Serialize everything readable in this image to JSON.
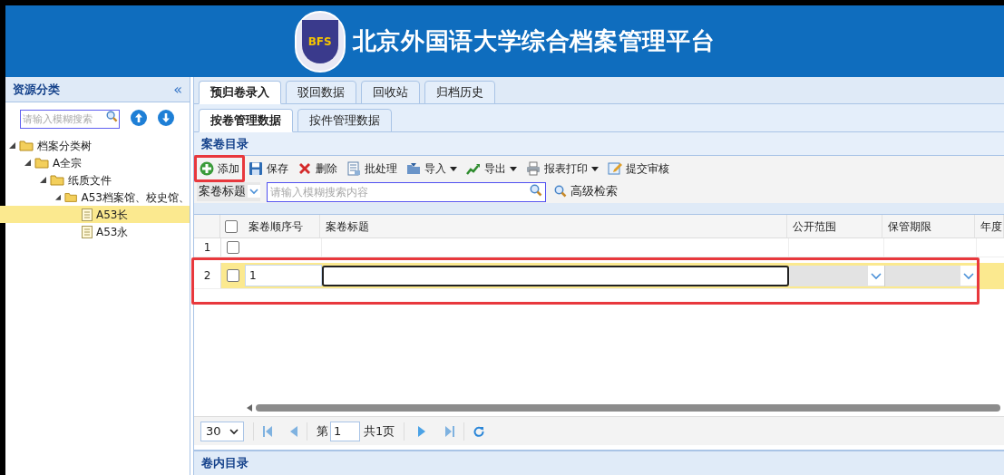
{
  "header": {
    "title": "北京外国语大学综合档案管理平台",
    "logo_text": "BFS"
  },
  "sidebar": {
    "title": "资源分类",
    "collapse": "«",
    "search": {
      "placeholder": "请输入模糊搜索"
    },
    "tree": [
      {
        "label": "档案分类树",
        "kind": "folder",
        "expanded": true,
        "selected": false,
        "children": [
          {
            "label": "A全宗",
            "kind": "folder",
            "expanded": true,
            "selected": false,
            "children": [
              {
                "label": "纸质文件",
                "kind": "folder",
                "expanded": true,
                "selected": false,
                "children": [
                  {
                    "label": "A53档案馆、校史馆、",
                    "kind": "folder",
                    "expanded": true,
                    "selected": false,
                    "children": [
                      {
                        "label": "A53长",
                        "kind": "file",
                        "selected": true
                      },
                      {
                        "label": "A53永",
                        "kind": "file",
                        "selected": false
                      }
                    ]
                  }
                ]
              }
            ]
          }
        ]
      }
    ]
  },
  "tabs": [
    {
      "label": "预归卷录入",
      "selected": true
    },
    {
      "label": "驳回数据",
      "selected": false
    },
    {
      "label": "回收站",
      "selected": false
    },
    {
      "label": "归档历史",
      "selected": false
    }
  ],
  "subtabs": [
    {
      "label": "按卷管理数据",
      "selected": true
    },
    {
      "label": "按件管理数据",
      "selected": false
    }
  ],
  "section_title": "案卷目录",
  "toolbar": [
    {
      "label": "添加",
      "kind": "add",
      "dropdown": false,
      "highlighted": true
    },
    {
      "label": "保存",
      "kind": "save",
      "dropdown": false,
      "highlighted": false
    },
    {
      "label": "删除",
      "kind": "delete",
      "dropdown": false,
      "highlighted": false
    },
    {
      "label": "批处理",
      "kind": "batch",
      "dropdown": false,
      "highlighted": false
    },
    {
      "label": "导入",
      "kind": "import",
      "dropdown": true,
      "highlighted": false
    },
    {
      "label": "导出",
      "kind": "export",
      "dropdown": true,
      "highlighted": false
    },
    {
      "label": "报表打印",
      "kind": "print",
      "dropdown": true,
      "highlighted": false
    },
    {
      "label": "提交审核",
      "kind": "submit",
      "dropdown": false,
      "highlighted": false
    }
  ],
  "filter": {
    "field": "案卷标题",
    "placeholder": "请输入模糊搜索内容",
    "advanced": "高级检索"
  },
  "grid": {
    "all_checked": false,
    "columns": [
      "案卷顺序号",
      "案卷标题",
      "公开范围",
      "保管期限",
      "年度"
    ],
    "rows": [
      {
        "number": "1",
        "selected": false,
        "checked": false,
        "editing": false,
        "highlighted": false,
        "order": ""
      },
      {
        "number": "2",
        "selected": true,
        "checked": false,
        "editing": true,
        "highlighted": true,
        "order": "1"
      }
    ]
  },
  "pager": {
    "page_size": "30",
    "page_prefix": "第",
    "page": "1",
    "total": "共1页"
  },
  "bottom_panel": {
    "title": "卷内目录"
  }
}
